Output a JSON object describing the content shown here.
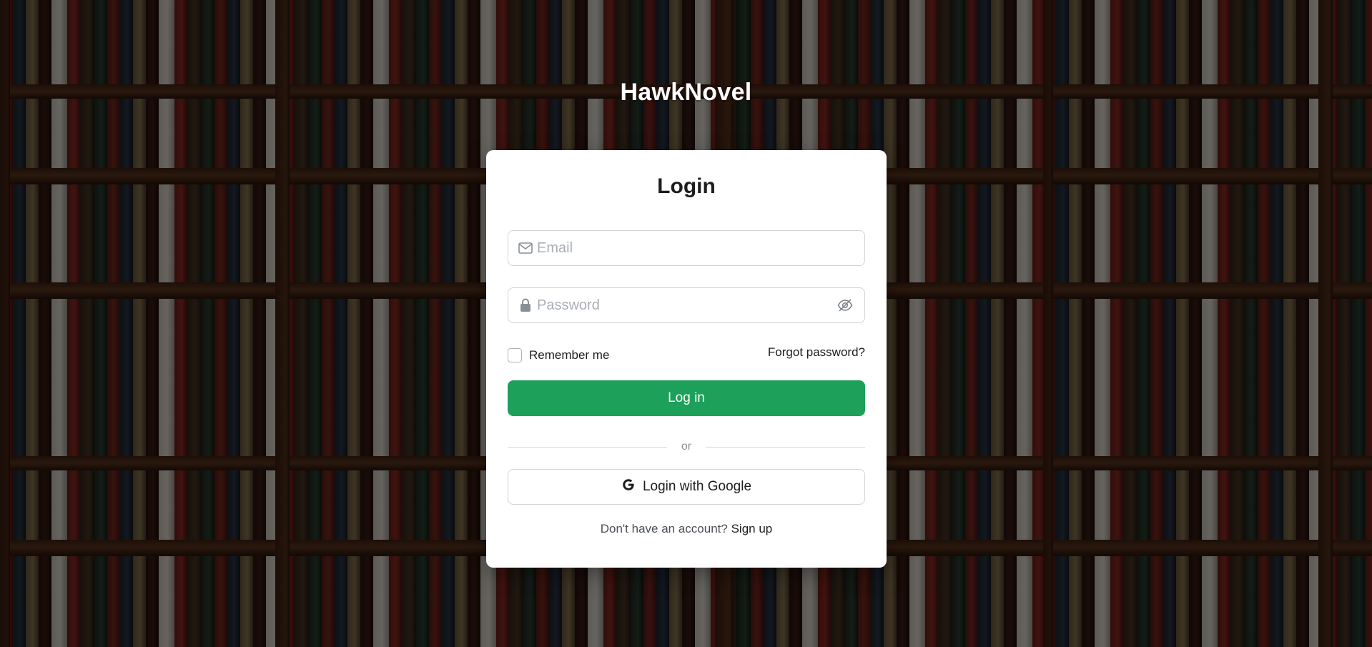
{
  "app": {
    "brand": "HawkNovel"
  },
  "login": {
    "title": "Login",
    "email": {
      "placeholder": "Email",
      "value": ""
    },
    "password": {
      "placeholder": "Password",
      "value": ""
    },
    "remember_label": "Remember me",
    "remember_checked": false,
    "forgot_label": "Forgot password?",
    "submit_label": "Log in",
    "divider_label": "or",
    "google_label": "Login with Google",
    "signup_prompt": "Don't have an account?",
    "signup_link": "Sign up"
  },
  "colors": {
    "primary_button": "#1da05a",
    "card_background": "#ffffff",
    "brand_text": "#ffffff"
  },
  "icons": {
    "email": "envelope-icon",
    "password": "lock-icon",
    "toggle_visibility": "eye-slash-icon",
    "google": "google-g-icon"
  },
  "background": "bookshelf-image"
}
